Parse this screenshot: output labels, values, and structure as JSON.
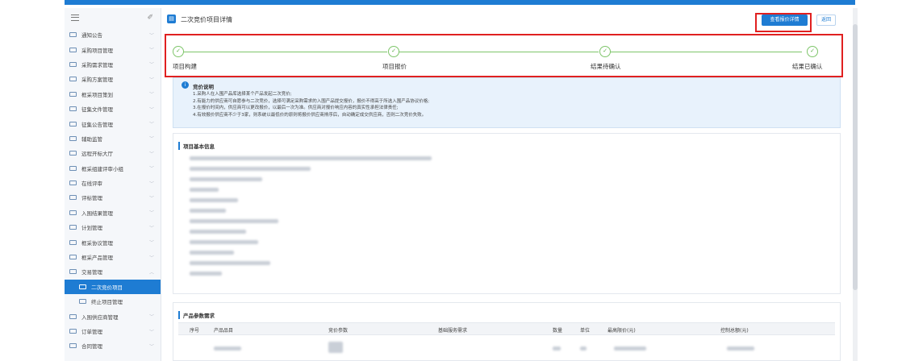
{
  "sidebar": {
    "items": [
      {
        "label": "通知公告"
      },
      {
        "label": "采购项目管理"
      },
      {
        "label": "采购需求管理"
      },
      {
        "label": "采购方案管理"
      },
      {
        "label": "框采项目策划"
      },
      {
        "label": "征集文件管理"
      },
      {
        "label": "征集公告管理"
      },
      {
        "label": "辅助监管"
      },
      {
        "label": "远程开标大厅"
      },
      {
        "label": "框采组建评审小组"
      },
      {
        "label": "在线评审"
      },
      {
        "label": "评标管理"
      },
      {
        "label": "入围结果管理"
      },
      {
        "label": "计划管理"
      },
      {
        "label": "框采协议管理"
      },
      {
        "label": "框采产品管理"
      },
      {
        "label": "交易管理"
      },
      {
        "label": "二次竞价项目"
      },
      {
        "label": "终止项目管理"
      },
      {
        "label": "入围供应商管理"
      },
      {
        "label": "订单管理"
      },
      {
        "label": "合同管理"
      }
    ]
  },
  "header": {
    "title": "二次竞价项目详情",
    "detail_button": "查看报价详情",
    "back_button": "返回"
  },
  "steps": [
    {
      "label": "项目构建"
    },
    {
      "label": "项目报价"
    },
    {
      "label": "结果待确认"
    },
    {
      "label": "结果已确认"
    }
  ],
  "notice": {
    "title": "竞价说明",
    "lines": [
      "1.采购人在入围产品库选择某个产品发起二次竞价;",
      "2.有能力的供应商可自愿参与二次竞价，选择可满足采购需求的入围产品提交报价，报价不得高于所选入围产品协议价格;",
      "3.在报价时间内，供应商可以更改报价，以最后一次为准。供应商对报价响应内容的真实性承担法律责任;",
      "4.有效报价供应商不少于3家，则系统以最低价的原则将报价供应商排序后，自动确定成交供应商，否则二次竞价失败。"
    ]
  },
  "basic_info": {
    "title": "项目基本信息"
  },
  "requirements": {
    "title": "产品参数需求",
    "columns": [
      "序号",
      "产品品目",
      "竞价参数",
      "基础服务需求",
      "数量",
      "单位",
      "最高限价(元)",
      "控制总额(元)"
    ]
  },
  "colors": {
    "accent": "#1e7cd3",
    "step_done": "#7ec56a",
    "highlight_box": "#e02020"
  }
}
